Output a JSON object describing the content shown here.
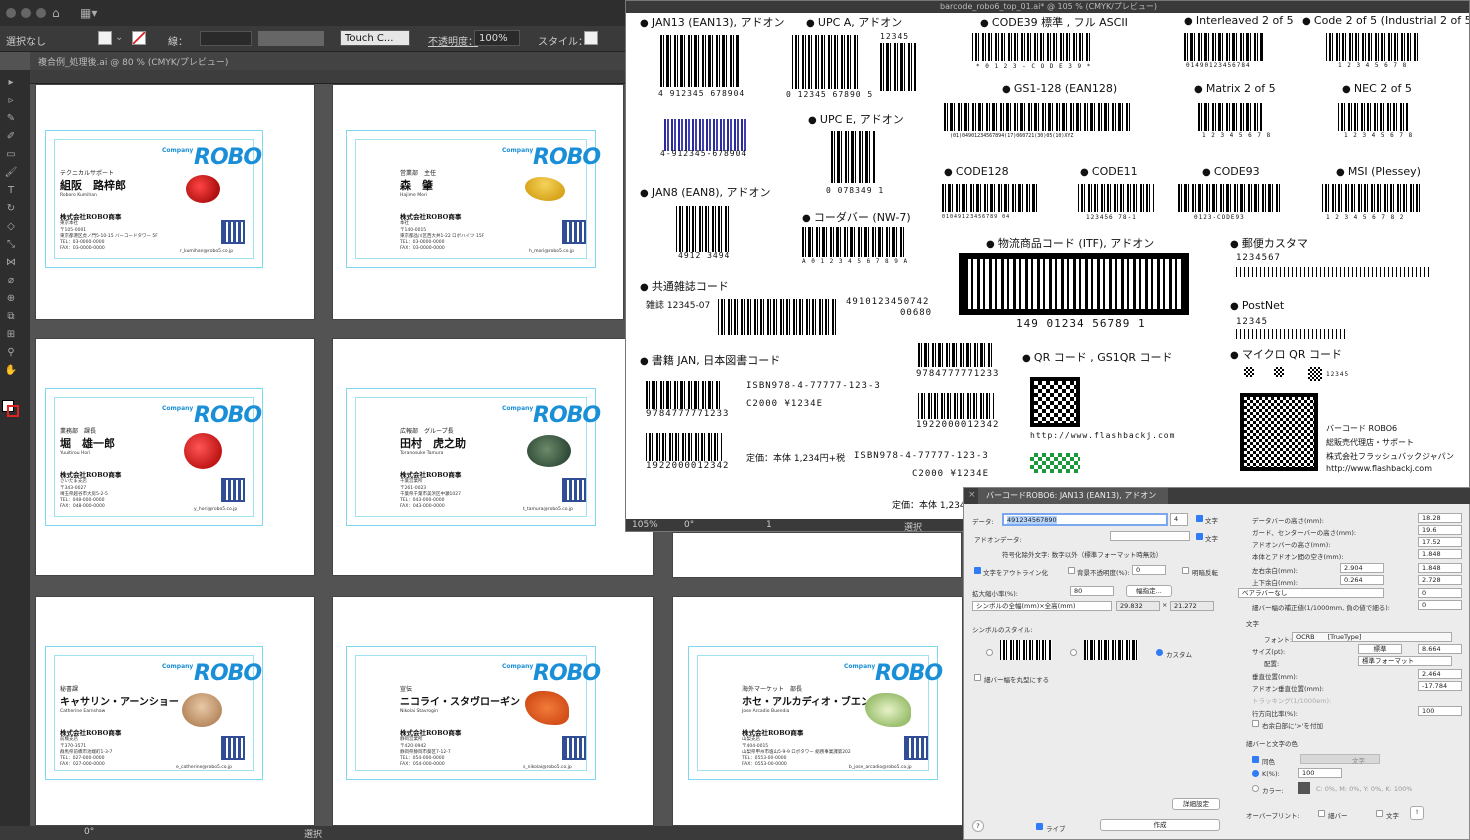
{
  "controlbar": {
    "selection": "選択なし",
    "stroke_label": "線：",
    "font_tag": "Touch C...",
    "opacity_label": "不透明度：",
    "opacity": "100%",
    "style_label": "スタイル："
  },
  "doc": {
    "tab": "複合例_処理後.ai @ 80 % (CMYK/プレビュー)"
  },
  "cards": [
    {
      "title": "テクニカルサポート",
      "name": "組阪　路梓郎",
      "roman": "Roboro Kumihan",
      "company": "株式会社ROBO商事",
      "branch": "東京本社",
      "addr": "〒105-0001\n東京都港区虎ノ門5-10-15 バーコードタワー 5F\nTEL：03-0000-0000\nFAX：03-0000-0000",
      "mail": "r_kumihan@robo5.co.jp"
    },
    {
      "title": "営業部　主任",
      "name": "森　肇",
      "roman": "Hajime Mori",
      "company": "株式会社ROBO商事",
      "branch": "本社",
      "addr": "〒140-0015\n東京都品川区西大井1-22 ロボハイツ 15F\nTEL：03-0000-0000\nFAX：03-0000-0000",
      "mail": "h_mori@robo5.co.jp"
    },
    {
      "title": "業務部　課長",
      "name": "堀　雄一郎",
      "roman": "Yuuitirou Hori",
      "company": "株式会社ROBO商事",
      "branch": "さいたま支店",
      "addr": "〒343-0027\n埼玉県越谷市大房5-2-5\nTEL：048-000-0000\nFAX：048-000-0000",
      "mail": "y_hori@robo5.co.jp"
    },
    {
      "title": "広報部　グループ長",
      "name": "田村　虎之助",
      "roman": "Toranosuke Tamura",
      "company": "株式会社ROBO商事",
      "branch": "千葉営業所",
      "addr": "〒261-0023\n千葉県千葉市美浜区中瀬1027\nTEL：043-000-0000\nFAX：043-000-0000",
      "mail": "t_tamura@robo5.co.jp"
    },
    {
      "title": "秘書課",
      "name": "キャサリン・アーンショー",
      "roman": "Catherine Earnshaw",
      "company": "株式会社ROBO商事",
      "branch": "前橋支店",
      "addr": "〒370-3571\n群馬県前橋市池端町1-3-7\nTEL：027-000-0000\nFAX：027-000-0000",
      "mail": "e_catherine@robo5.co.jp"
    },
    {
      "title": "宣伝",
      "name": "ニコライ・スタヴローギン",
      "roman": "Nikolai Stavrogin",
      "company": "株式会社ROBO商事",
      "branch": "静岡営業所",
      "addr": "〒420-0942\n静岡県静岡市葵区7-12-7\nTEL：054-000-0000\nFAX：054-000-0000",
      "mail": "s_nikolai@robo5.co.jp"
    },
    {
      "title": "海外マーケット　部長",
      "name": "ホセ・アルカディオ・ブエンディア",
      "roman": "Jose Arcadio Buendia",
      "company": "株式会社ROBO商事",
      "branch": "山梨支店",
      "addr": "〒404-0015\n山梨県甲州市塩山5-9-9 ロボタワー 総務事業課第202\nTEL：0553-00-0000\nFAX：0553-00-0000",
      "mail": "b_jose_arcadio@robo5.co.jp"
    }
  ],
  "card_brand": {
    "company": "Company",
    "logo": "ROBO"
  },
  "barcode_window": {
    "title": "barcode_robo6_top_01.ai* @ 105 % (CMYK/プレビュー)",
    "labels": {
      "jan13": "JAN13 (EAN13), アドオン",
      "upca": "UPC A, アドオン",
      "code39": "CODE39 標準 , フル ASCII",
      "i2of5": "Interleaved 2 of 5",
      "c2of5": "Code 2 of 5 (Industrial 2 of 5)",
      "upce": "UPC E, アドオン",
      "gs1": "GS1-128 (EAN128)",
      "matrix": "Matrix 2 of 5",
      "nec": "NEC 2 of 5",
      "jan8": "JAN8 (EAN8), アドオン",
      "code128": "CODE128",
      "code11": "CODE11",
      "code93": "CODE93",
      "msi": "MSI (Plessey)",
      "nw7": "コーダバー (NW-7)",
      "itf": "物流商品コード (ITF), アドオン",
      "postal": "郵便カスタマ",
      "magazine": "共通雑誌コード",
      "postnet": "PostNet",
      "book": "書籍 JAN, 日本図書コード",
      "qr": "QR コード , GS1QR コード",
      "microqr": "マイクロ QR コード"
    },
    "numbers": {
      "jan13": "4 912345 678904",
      "upca": "0 12345 67890 5",
      "upca_addon": "12345",
      "jan13b": "4-912345-678904",
      "upce": "0 078349 1",
      "jan8": "4912 3494",
      "nw7": "A 0 1 2 3 4 5 6 7 8 9 A",
      "code39": "* 0 1 2 3 - C O D E 3 9 *",
      "i2of5": "01490123456784",
      "c2of5": "1 2 3 4 5 6 7 8",
      "gs1": "(01)04901234567894(17)060721(30)05(10)XYZ",
      "matrix": "1 2 3 4 5 6 7 8",
      "nec": "1 2 3 4 5 6 7 8",
      "code128": "01049123456789 04",
      "code11": "123456 78-1",
      "code93": "0123-CODE93",
      "msi": "1 2 3 4 5 6 7 8 2",
      "itf": "149 01234 56789 1",
      "postal": "1234567",
      "postnet": "12345",
      "magazine_label": "雑誌 12345-07",
      "magazine_num": "4910123450742",
      "magazine_add": "00680",
      "book1": "9784777771233",
      "book2": "1922000012342",
      "isbn": "ISBN978-4-77777-123-3",
      "c2000": "C2000 ¥1234E",
      "price": "定価：本体 1,234円+税",
      "isbn2": "ISBN978-4-77777-123-3",
      "c2000b": "C2000 ¥1234E",
      "price2": "定価：本体 1,234",
      "bookside1": "9784777771233",
      "bookside2": "1922000012342",
      "url": "http://www.flashbackj.com",
      "robo_name": "バーコード ROBO6",
      "robo_sales": "総販売代理店・サポート",
      "robo_company": "株式会社フラッシュバックジャパン",
      "robo_url": "http://www.flashbackj.com",
      "microqr_num": "12345"
    },
    "status": {
      "zoom": "105%",
      "angle": "0°",
      "page": "1",
      "mode": "選択"
    }
  },
  "dialog": {
    "title": "バーコードROBO6: JAN13 (EAN13), アドオン",
    "data_label": "データ:",
    "data_value": "491234567890",
    "data_addon": "4",
    "text_label": "文字",
    "addon_label": "アドオンデータ:",
    "note": "符号化除外文字: 数字以外（標準フォーマット時無効）",
    "outline": "文字をアウトライン化",
    "bg_opacity": "背景不透明度(%):",
    "bg_value": "0",
    "bright": "明暗反転",
    "scale_label": "拡大縮小率(%):",
    "scale_value": "80",
    "width_btn": "幅指定...",
    "size_mode": "シンボルの全幅(mm)×全高(mm)",
    "size_w": "29.832",
    "size_h": "21.272",
    "style_label": "シンボルのスタイル:",
    "custom": "カスタム",
    "round": "細バー幅を丸型にする",
    "r1": "データバーの高さ(mm):",
    "r1v": "18.28",
    "r2": "ガード、センターバーの高さ(mm):",
    "r2v": "19.6",
    "r3": "アドオンバーの高さ(mm):",
    "r3v": "17.52",
    "r4": "本体とアドオン間の空き(mm):",
    "r4v": "1.848",
    "r5": "左右余白(mm):",
    "r5a": "2.904",
    "r5b": "1.848",
    "r6": "上下余白(mm):",
    "r6a": "0.264",
    "r6b": "2.728",
    "r7": "ベアラバーなし",
    "r7v": "0",
    "r8": "細バー幅の補正値(1/1000mm, 負の値で細る):",
    "r8v": "0",
    "textsec": "文字",
    "font_label": "フォント:",
    "font_value": "OCRB",
    "font_type": "[TrueType]",
    "size_label": "サイズ(pt):",
    "size_std": "標準",
    "size_value": "8.664",
    "align_label": "配置:",
    "align_value": "標準フォーマット",
    "v1": "垂直位置(mm):",
    "v1v": "2.464",
    "v2": "アドオン垂直位置(mm):",
    "v2v": "-17.784",
    "v3": "トラッキング(1/1000em):",
    "v4": "行方向比率(%):",
    "v4v": "100",
    "v5": "右余白部に'>'を付加",
    "color_sec": "細バーと文字の色",
    "same": "同色",
    "text_tab": "文字",
    "k_label": "K(%):",
    "k_value": "100",
    "color_label": "カラー:",
    "cmyk": "C: 0%, M: 0%, Y: 0%, K: 100%",
    "detail": "詳細設定",
    "overprint": "オーバープリント:",
    "op_bar": "細バー",
    "op_text": "文字",
    "help": "?",
    "live": "ライブ",
    "create": "作成"
  },
  "bottom": {
    "angle": "0°",
    "mode": "選択"
  }
}
